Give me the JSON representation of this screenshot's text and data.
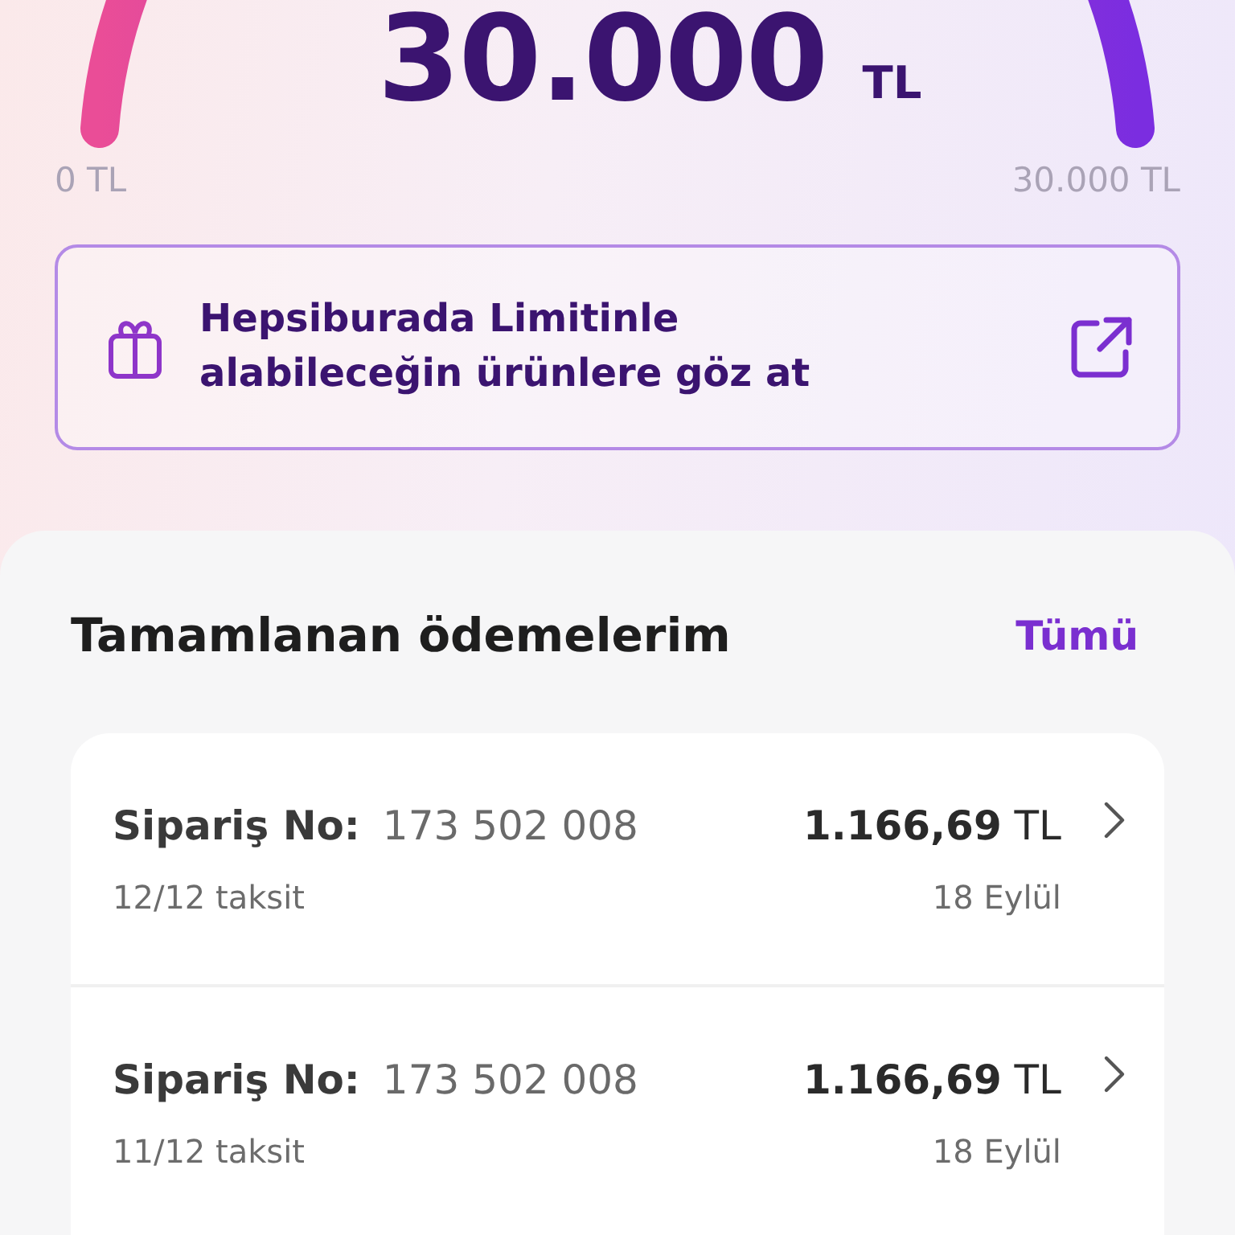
{
  "limit": {
    "amount": "30.000",
    "currency": "TL",
    "min_label": "0 TL",
    "max_label": "30.000 TL"
  },
  "promo": {
    "text": "Hepsiburada Limitinle alabileceğin ürünlere göz at"
  },
  "payments": {
    "title": "Tamamlanan ödemelerim",
    "see_all": "Tümü",
    "rows": [
      {
        "order_label": "Sipariş No:",
        "order_no": "173 502 008",
        "amount": "**1.166,69** TL",
        "installment": "12/12 taksit",
        "date": "18 Eylül"
      },
      {
        "order_label": "Sipariş No:",
        "order_no": "173 502 008",
        "amount": "**1.166,69** TL",
        "installment": "11/12 taksit",
        "date": "18 Eylül"
      }
    ]
  }
}
